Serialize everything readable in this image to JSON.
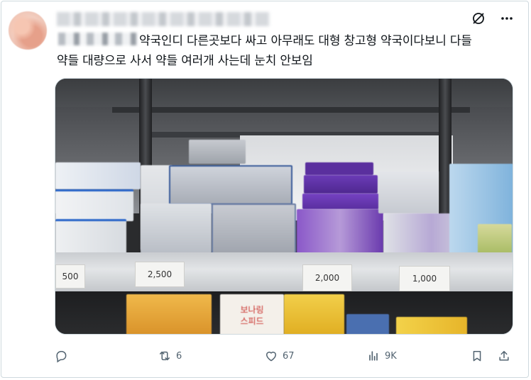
{
  "post": {
    "text_line1": "약국인디 다른곳보다 싸고 아무래도 대형 창고형 약국이다보니 다들",
    "text_line2": "약들 대량으로 사서 약들 여러개 사는데 눈치 안보임"
  },
  "prices": [
    "500",
    "2,500",
    "2,000",
    "1,000"
  ],
  "lower_sign": [
    "보나링",
    "스피드"
  ],
  "metrics": {
    "replies": "",
    "reposts": "6",
    "likes": "67",
    "views": "9K"
  },
  "icons": {
    "grok": "grok-icon",
    "more": "more-icon",
    "reply": "reply-icon",
    "repost": "repost-icon",
    "like": "heart-icon",
    "views": "views-icon",
    "bookmark": "bookmark-icon",
    "share": "share-icon"
  }
}
